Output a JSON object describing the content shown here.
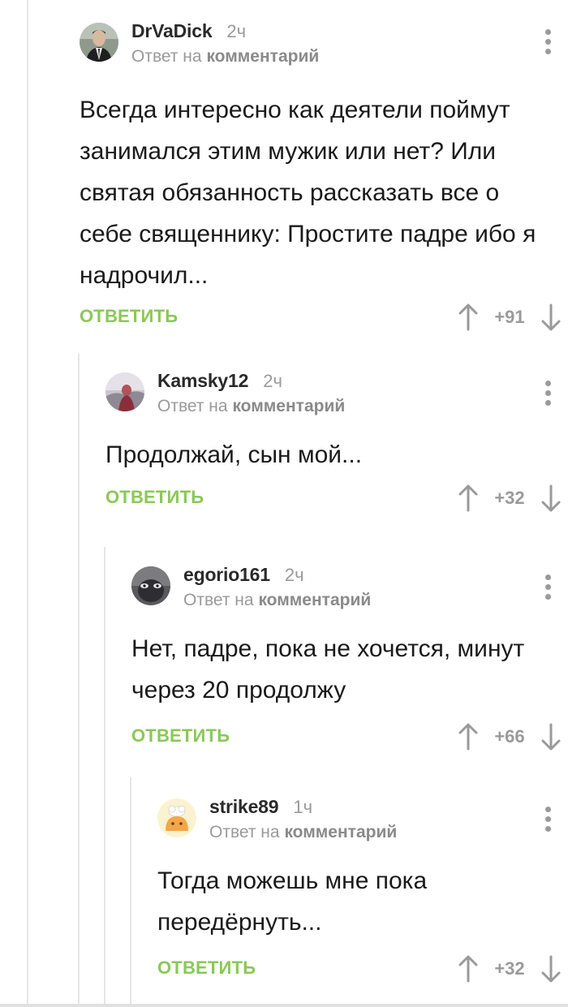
{
  "comments": [
    {
      "author": "DrVaDick",
      "time": "2ч",
      "reply_prefix": "Ответ на",
      "reply_target": "комментарий",
      "text": "Всегда интересно как деятели поймут занимался этим мужик или нет? Или святая обязанность рассказать все о себе священнику: Простите падре ибо я надрочил...",
      "reply_label": "ОТВЕТИТЬ",
      "score": "+91"
    },
    {
      "author": "Kamsky12",
      "time": "2ч",
      "reply_prefix": "Ответ на",
      "reply_target": "комментарий",
      "text": "Продолжай, сын мой...",
      "reply_label": "ОТВЕТИТЬ",
      "score": "+32"
    },
    {
      "author": "egorio161",
      "time": "2ч",
      "reply_prefix": "Ответ на",
      "reply_target": "комментарий",
      "text": "Нет, падре, пока не хочется, минут через 20 продолжу",
      "reply_label": "ОТВЕТИТЬ",
      "score": "+66"
    },
    {
      "author": "strike89",
      "time": "1ч",
      "reply_prefix": "Ответ на",
      "reply_target": "комментарий",
      "text": "Тогда можешь мне пока передёрнуть...",
      "reply_label": "ОТВЕТИТЬ",
      "score": "+32"
    }
  ],
  "colors": {
    "accent_green": "#8ac858",
    "muted_gray": "#9a9a9a",
    "thread_line": "#e6e6e6"
  },
  "icons": {
    "menu": "three-dots-vertical-icon",
    "upvote": "arrow-up-icon",
    "downvote": "arrow-down-icon"
  }
}
